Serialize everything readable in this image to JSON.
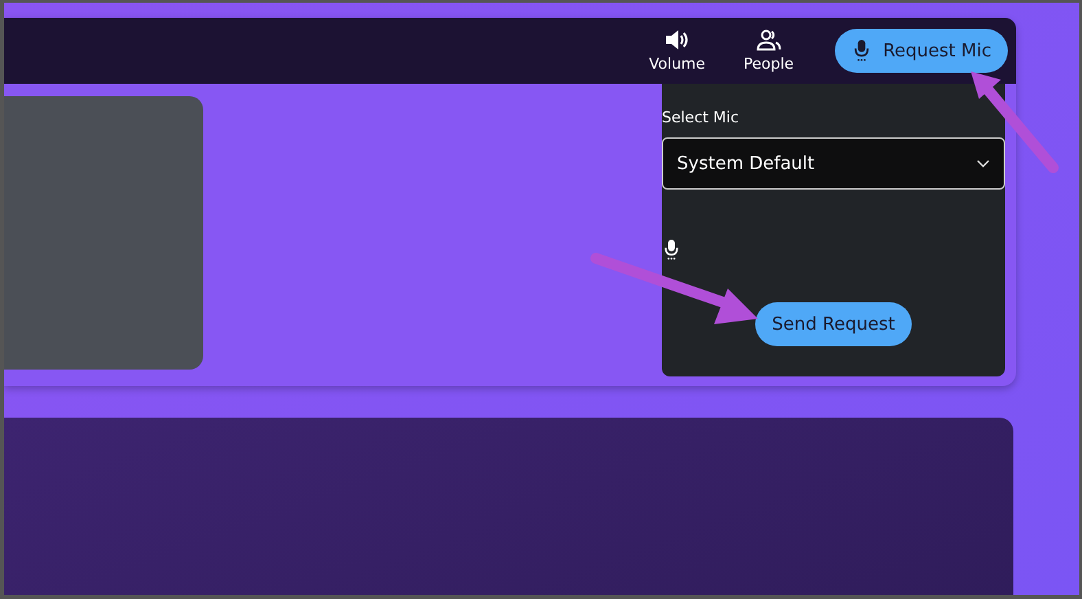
{
  "toolbar": {
    "buttons": [
      {
        "kind": "volume",
        "label": "Volume"
      },
      {
        "kind": "people",
        "label": "People"
      }
    ],
    "request_button": {
      "label": "Request Mic"
    }
  },
  "mic_panel": {
    "title": "Select Mic",
    "select": {
      "value": "System Default"
    },
    "send_button": {
      "label": "Send Request"
    }
  },
  "annotations": [
    {
      "kind": "arrow"
    },
    {
      "kind": "arrow"
    }
  ]
}
